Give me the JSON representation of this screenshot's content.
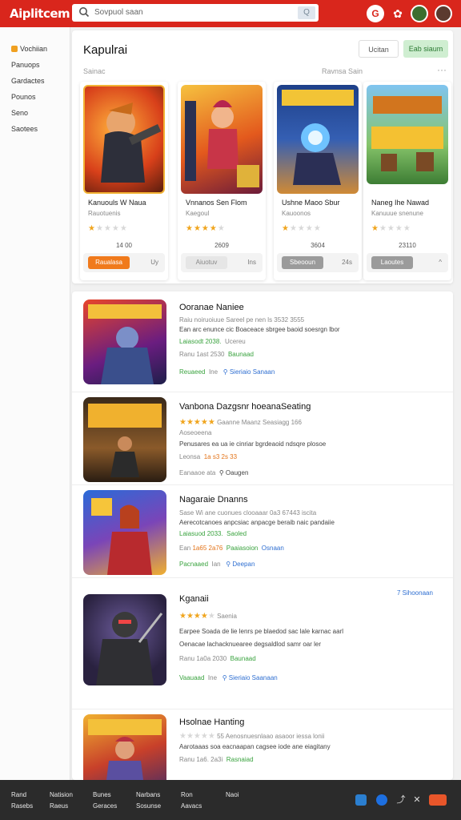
{
  "topbar": {
    "logo": "Aiplitcem",
    "search_placeholder": "Sovpuol saan",
    "search_btn": "Q"
  },
  "sidebar": {
    "items": [
      {
        "label": "Vochiian"
      },
      {
        "label": "Panuops"
      },
      {
        "label": "Gardactes"
      },
      {
        "label": "Pounos"
      },
      {
        "label": "Seno"
      },
      {
        "label": "Saotees"
      }
    ]
  },
  "featured": {
    "title": "Kapulrai",
    "btn_secondary": "Ucitan",
    "btn_primary": "Eab siaum",
    "subtitle": "Sainac",
    "subtitle_right": "Ravnsa   Sain",
    "cards": [
      {
        "title": "Kanuouls W Naua",
        "sub": "Rauotuenis",
        "stars": 1,
        "num": "14 00",
        "btn": "Raualasa",
        "meta": "Uy",
        "color": "#f07a1c"
      },
      {
        "title": "Vnnanos Sen Flom",
        "sub": "Kaegoul",
        "stars": 4,
        "num": "2609",
        "btn": "Aiuotuv",
        "meta": "Ins",
        "color": "#e6e6e6"
      },
      {
        "title": "Ushne Maoo Sbur",
        "sub": "Kauoonos",
        "stars": 1,
        "num": "3604",
        "btn": "Sbeooun",
        "meta": "24s",
        "color": "#9b9b9b"
      },
      {
        "title": "Naneg Ihe Nawad",
        "sub": "Kanuuue snenune",
        "stars": 1,
        "num": "23110",
        "btn": "Laoutes",
        "meta": "^",
        "color": "#9b9b9b"
      }
    ]
  },
  "list": {
    "rows": [
      {
        "title": "Ooranae Naniee",
        "l1": "Raiu noiruoiuue Sareel pe nen ls 3532 3555",
        "l2": "Ean arc enunce cic Boaceace sbrgee baoid soesrgn lbor",
        "l3a": "Laiasodt 2038.",
        "l3b": "Ucereu",
        "l4a": "Ranu 1ast 2530",
        "l4b": "Baunaad",
        "l5a": "Reuaeed",
        "l5b": "Ine",
        "l5c": "Sieriaio Sanaan"
      },
      {
        "title": "Vanbona Dazgsnr hoeanaSeating",
        "l1": "Gaanne Maanz    Seasiagg 166",
        "l2": "Aoseoeena",
        "l3": "Penusares ea ua ie cinriar bgrdeaoid ndsqre plosoe",
        "l4a": "Leonsa",
        "l4b": "1a s3 2s 33",
        "l5a": "Eanaaoe ata",
        "l5b": "Oaugen"
      },
      {
        "title": "Nagaraie Dnanns",
        "l1": "Sase Wi ane cuonues clooaaar 0a3 67443 iscita",
        "l2": "Aerecotcanoes anpcsiac anpacge beraib naic pandaiie",
        "l3a": "Laiasuod 2033.",
        "l3b": "Saoled",
        "l4a": "Ean",
        "l4b": "1a65 2a76",
        "l4c": "Paaiasoion",
        "l4d": "Osnaan",
        "l5a": "Pacnaaed",
        "l5b": "Ian",
        "l5c": "Deepan"
      },
      {
        "title": "Kganaii",
        "badge": "7 Sihoonaan",
        "l1": "Saenia",
        "l2": "Earpee Soada de lie lenrs pe blaedod sac lale karnac aarl",
        "l3": "Oenacae lachacknuearee degsaldlod samr oar ler",
        "l4a": "Ranu 1a0a",
        "l4b": "2030",
        "l4c": "Baunaad",
        "l5a": "Vaauaad",
        "l5b": "Ine",
        "l5c": "Sieriaio Saanaan"
      },
      {
        "title": "Hsolnae Hanting",
        "l1": "55 Aenosnuesnlaao asaoor iessa lonii",
        "l2": "Aarotaaas soa eacnaapan cagsee iode ane eiagitany",
        "l3a": "Ranu 1a6.",
        "l3b": "2a3i",
        "l3c": "Rasnaiad"
      }
    ]
  },
  "bottombar": {
    "col1": [
      "Rand",
      "Rasebs"
    ],
    "col2": [
      "Natision",
      "Raeus"
    ],
    "col3": [
      "Bunes",
      "Geraces"
    ],
    "col4": [
      "Narbans",
      "Sosunse"
    ],
    "col5": [
      "Ron",
      "Aavacs"
    ],
    "col6": [
      "Naoi"
    ]
  }
}
